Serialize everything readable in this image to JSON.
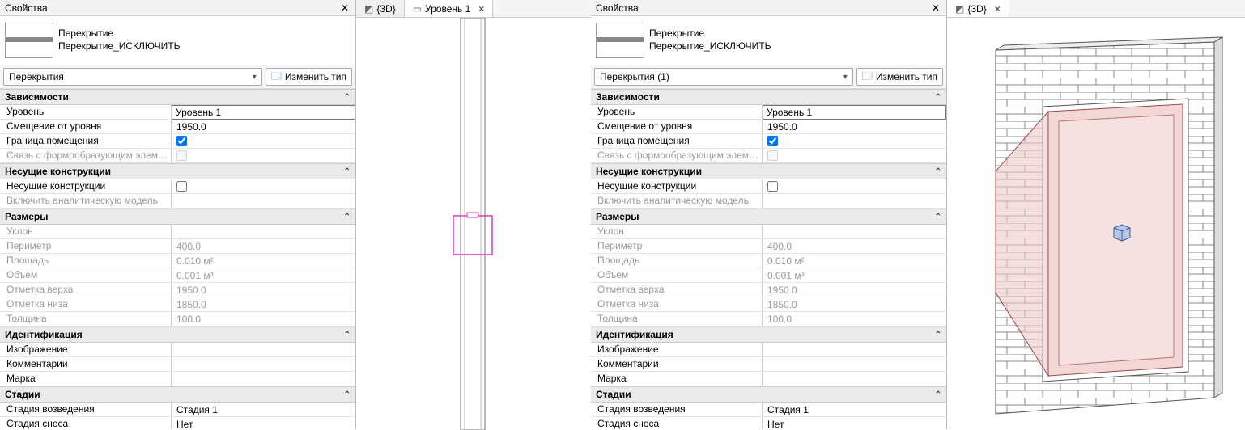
{
  "left": {
    "panel_title": "Свойства",
    "type": {
      "family": "Перекрытие",
      "name": "Перекрытие_ИСКЛЮЧИТЬ"
    },
    "category_dropdown": "Перекрытия",
    "edit_type_label": "Изменить тип",
    "groups": [
      {
        "title": "Зависимости",
        "rows": [
          {
            "label": "Уровень",
            "value": "Уровень 1",
            "kind": "text",
            "boxed": true
          },
          {
            "label": "Смещение от уровня",
            "value": "1950.0",
            "kind": "text"
          },
          {
            "label": "Граница помещения",
            "value": true,
            "kind": "check"
          },
          {
            "label": "Связь с формообразующим элеме...",
            "value": false,
            "kind": "check",
            "dim": true
          }
        ]
      },
      {
        "title": "Несущие конструкции",
        "rows": [
          {
            "label": "Несущие конструкции",
            "value": false,
            "kind": "check"
          },
          {
            "label": "Включить аналитическую модель",
            "value": "",
            "kind": "text",
            "dim": true
          }
        ]
      },
      {
        "title": "Размеры",
        "rows": [
          {
            "label": "Уклон",
            "value": "",
            "kind": "text",
            "dim": true
          },
          {
            "label": "Периметр",
            "value": "400.0",
            "kind": "text",
            "dim": true
          },
          {
            "label": "Площадь",
            "value": "0.010 м²",
            "kind": "text",
            "dim": true
          },
          {
            "label": "Объем",
            "value": "0.001 м³",
            "kind": "text",
            "dim": true
          },
          {
            "label": "Отметка верха",
            "value": "1950.0",
            "kind": "text",
            "dim": true
          },
          {
            "label": "Отметка низа",
            "value": "1850.0",
            "kind": "text",
            "dim": true
          },
          {
            "label": "Толщина",
            "value": "100.0",
            "kind": "text",
            "dim": true
          }
        ]
      },
      {
        "title": "Идентификация",
        "rows": [
          {
            "label": "Изображение",
            "value": "",
            "kind": "text"
          },
          {
            "label": "Комментарии",
            "value": "",
            "kind": "text"
          },
          {
            "label": "Марка",
            "value": "",
            "kind": "text"
          }
        ]
      },
      {
        "title": "Стадии",
        "rows": [
          {
            "label": "Стадия возведения",
            "value": "Стадия 1",
            "kind": "text"
          },
          {
            "label": "Стадия сноса",
            "value": "Нет",
            "kind": "text"
          }
        ]
      }
    ]
  },
  "plan_view": {
    "tab_inactive": "{3D}",
    "tab_active": "Уровень 1"
  },
  "right": {
    "panel_title": "Свойства",
    "type": {
      "family": "Перекрытие",
      "name": "Перекрытие_ИСКЛЮЧИТЬ"
    },
    "category_dropdown": "Перекрытия (1)",
    "edit_type_label": "Изменить тип",
    "groups": [
      {
        "title": "Зависимости",
        "rows": [
          {
            "label": "Уровень",
            "value": "Уровень 1",
            "kind": "text",
            "boxed": true
          },
          {
            "label": "Смещение от уровня",
            "value": "1950.0",
            "kind": "text"
          },
          {
            "label": "Граница помещения",
            "value": true,
            "kind": "check"
          },
          {
            "label": "Связь с формообразующим элеме...",
            "value": false,
            "kind": "check",
            "dim": true
          }
        ]
      },
      {
        "title": "Несущие конструкции",
        "rows": [
          {
            "label": "Несущие конструкции",
            "value": false,
            "kind": "check"
          },
          {
            "label": "Включить аналитическую модель",
            "value": "",
            "kind": "text",
            "dim": true
          }
        ]
      },
      {
        "title": "Размеры",
        "rows": [
          {
            "label": "Уклон",
            "value": "",
            "kind": "text",
            "dim": true
          },
          {
            "label": "Периметр",
            "value": "400.0",
            "kind": "text",
            "dim": true
          },
          {
            "label": "Площадь",
            "value": "0.010 м²",
            "kind": "text",
            "dim": true
          },
          {
            "label": "Объем",
            "value": "0.001 м³",
            "kind": "text",
            "dim": true
          },
          {
            "label": "Отметка верха",
            "value": "1950.0",
            "kind": "text",
            "dim": true
          },
          {
            "label": "Отметка низа",
            "value": "1850.0",
            "kind": "text",
            "dim": true
          },
          {
            "label": "Толщина",
            "value": "100.0",
            "kind": "text",
            "dim": true
          }
        ]
      },
      {
        "title": "Идентификация",
        "rows": [
          {
            "label": "Изображение",
            "value": "",
            "kind": "text"
          },
          {
            "label": "Комментарии",
            "value": "",
            "kind": "text"
          },
          {
            "label": "Марка",
            "value": "",
            "kind": "text"
          }
        ]
      },
      {
        "title": "Стадии",
        "rows": [
          {
            "label": "Стадия возведения",
            "value": "Стадия 1",
            "kind": "text"
          },
          {
            "label": "Стадия сноса",
            "value": "Нет",
            "kind": "text"
          }
        ]
      }
    ]
  },
  "iso_view": {
    "tab_active": "{3D}"
  }
}
